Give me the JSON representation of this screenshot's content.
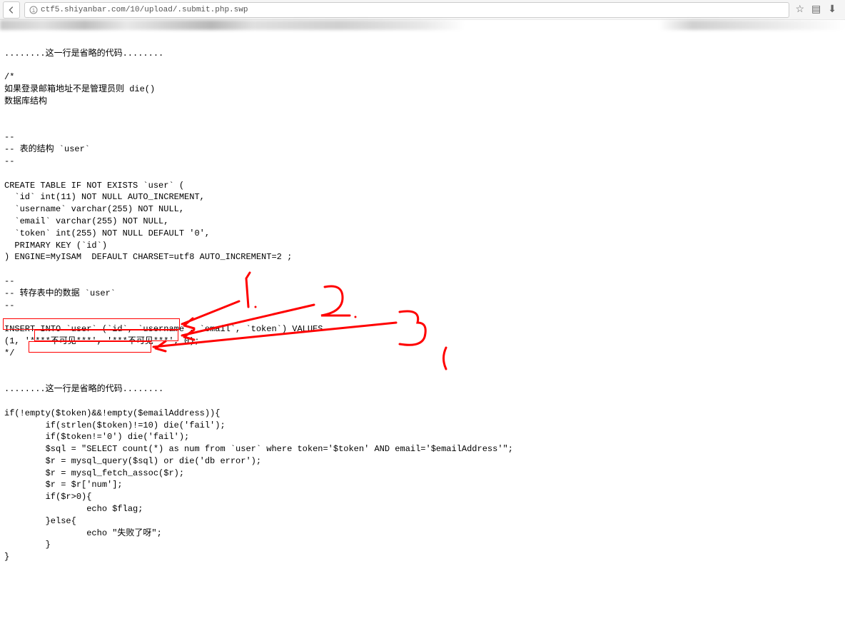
{
  "browser": {
    "url": "ctf5.shiyanbar.com/10/upload/.submit.php.swp"
  },
  "code": {
    "line_omit1": "........这一行是省略的代码........",
    "comment_start": "/*",
    "comment_1": "如果登录邮箱地址不是管理员则 die()",
    "comment_2": "数据库结构",
    "dash1": "--",
    "dash2": "-- 表的结构 `user`",
    "dash3": "--",
    "create1": "CREATE TABLE IF NOT EXISTS `user` (",
    "create2": "  `id` int(11) NOT NULL AUTO_INCREMENT,",
    "create3": "  `username` varchar(255) NOT NULL,",
    "create4": "  `email` varchar(255) NOT NULL,",
    "create5": "  `token` int(255) NOT NULL DEFAULT '0',",
    "create6": "  PRIMARY KEY (`id`)",
    "create7": ") ENGINE=MyISAM  DEFAULT CHARSET=utf8 AUTO_INCREMENT=2 ;",
    "dash4": "--",
    "dash5": "-- 转存表中的数据 `user`",
    "dash6": "--",
    "insert1": "INSERT INTO `user` (`id`, `username`, `email`, `token`) VALUES",
    "insert2": "(1, '****不可见***', '***不可见***', 0);",
    "comment_end": "*/",
    "line_omit2": "........这一行是省略的代码........",
    "if1": "if(!empty($token)&&!empty($emailAddress)){",
    "if2": "        if(strlen($token)!=10) die('fail');",
    "if3": "        if($token!='0') die('fail');",
    "if4": "        $sql = \"SELECT count(*) as num from `user` where token='$token' AND email='$emailAddress'\";",
    "if5": "        $r = mysql_query($sql) or die('db error');",
    "if6": "        $r = mysql_fetch_assoc($r);",
    "if7": "        $r = $r['num'];",
    "if8": "        if($r>0){",
    "if9": "                echo $flag;",
    "if10": "        }else{",
    "if11": "                echo \"失败了呀\";",
    "if12": "        }",
    "if13": "}"
  },
  "annotations": {
    "label1": "1.",
    "label2": "2.",
    "label3": "3."
  }
}
